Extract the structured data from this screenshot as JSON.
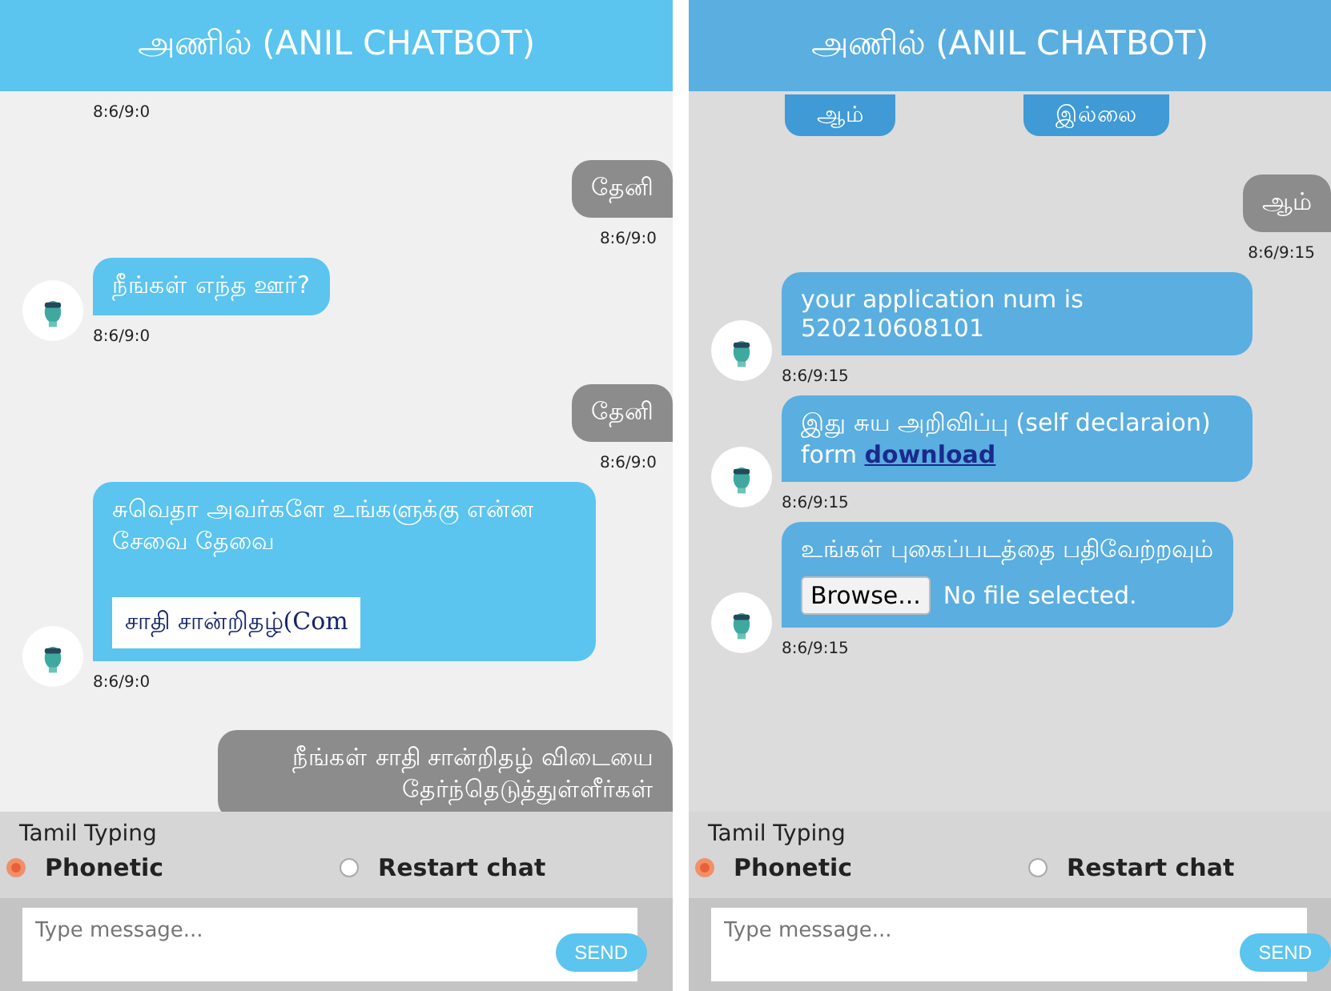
{
  "panels": [
    {
      "title": "அணில் (ANIL CHATBOT)",
      "messages": [
        {
          "kind": "timestamp",
          "time": "8:6/9:0"
        },
        {
          "kind": "user",
          "text": "தேனி",
          "time": "8:6/9:0"
        },
        {
          "kind": "bot",
          "text": "நீங்கள் எந்த ஊர்?",
          "time": "8:6/9:0"
        },
        {
          "kind": "user",
          "text": "தேனி",
          "time": "8:6/9:0"
        },
        {
          "kind": "bot",
          "text": "சுவெதா அவர்களே உங்களுக்கு என்ன சேவை தேவை",
          "option": "சாதி சான்றிதழ்(Com",
          "time": "8:6/9:0"
        },
        {
          "kind": "user",
          "text": "நீங்கள் சாதி சான்றிதழ் விடையை தேர்ந்தெடுத்துள்ளீர்கள்"
        }
      ],
      "typing_label": "Tamil Typing",
      "radios": [
        {
          "label": "Phonetic",
          "selected": true
        },
        {
          "label": "Restart chat",
          "selected": false
        }
      ],
      "input": {
        "placeholder": "Type message..."
      },
      "send": "SEND"
    },
    {
      "title": "அணில் (ANIL CHATBOT)",
      "messages": [
        {
          "kind": "choices",
          "choices": [
            "ஆம்",
            "இல்லை"
          ]
        },
        {
          "kind": "user",
          "text": "ஆம்",
          "time": "8:6/9:15"
        },
        {
          "kind": "bot",
          "text": "your application num is 520210608101",
          "time": "8:6/9:15"
        },
        {
          "kind": "bot",
          "text": "இது சுய அறிவிப்பு (self declaraion) form",
          "link": "download",
          "time": "8:6/9:15"
        },
        {
          "kind": "bot",
          "text": "உங்கள் புகைப்படத்தை பதிவேற்றவும்",
          "upload": {
            "button": "Browse...",
            "status": "No file selected."
          },
          "time": "8:6/9:15"
        }
      ],
      "typing_label": "Tamil Typing",
      "radios": [
        {
          "label": "Phonetic",
          "selected": true
        },
        {
          "label": "Restart chat",
          "selected": false
        }
      ],
      "input": {
        "placeholder": "Type message..."
      },
      "send": "SEND"
    }
  ]
}
